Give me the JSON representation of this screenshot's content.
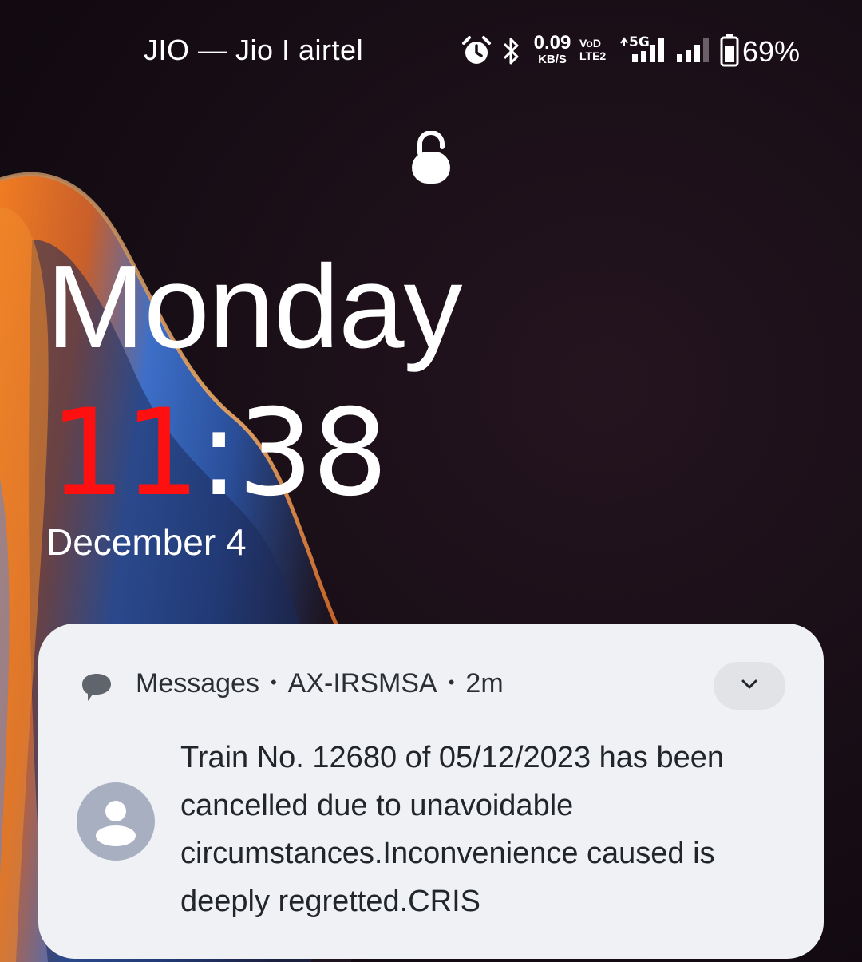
{
  "status_bar": {
    "carrier": "JIO — Jio I airtel",
    "net_speed_value": "0.09",
    "net_speed_unit": "KB/S",
    "volte_top": "VoD",
    "volte_bottom": "LTE2",
    "sim1_network": "5G",
    "battery_percent": "69%",
    "icons": [
      "alarm-icon",
      "bluetooth-icon",
      "signal-sim1-icon",
      "signal-sim2-icon",
      "battery-icon"
    ]
  },
  "lockscreen": {
    "lock_icon": "lock-icon",
    "weekday": "Monday",
    "time_hours": "11",
    "time_separator": ":",
    "time_minutes": "38",
    "date": "December 4"
  },
  "notification": {
    "app_icon": "messages-icon",
    "app_name": "Messages",
    "sender": "AX-IRSMSA",
    "time_ago": "2m",
    "separator": "•",
    "expand_icon": "chevron-down-icon",
    "avatar_icon": "person-icon",
    "body": "Train No. 12680 of 05/12/2023 has been cancelled due to unavoidable circumstances.Inconvenience caused is deeply regretted.CRIS"
  },
  "colors": {
    "hours": "#ff1010",
    "card_background": "#eff1f4",
    "avatar": "#a7afc0"
  }
}
